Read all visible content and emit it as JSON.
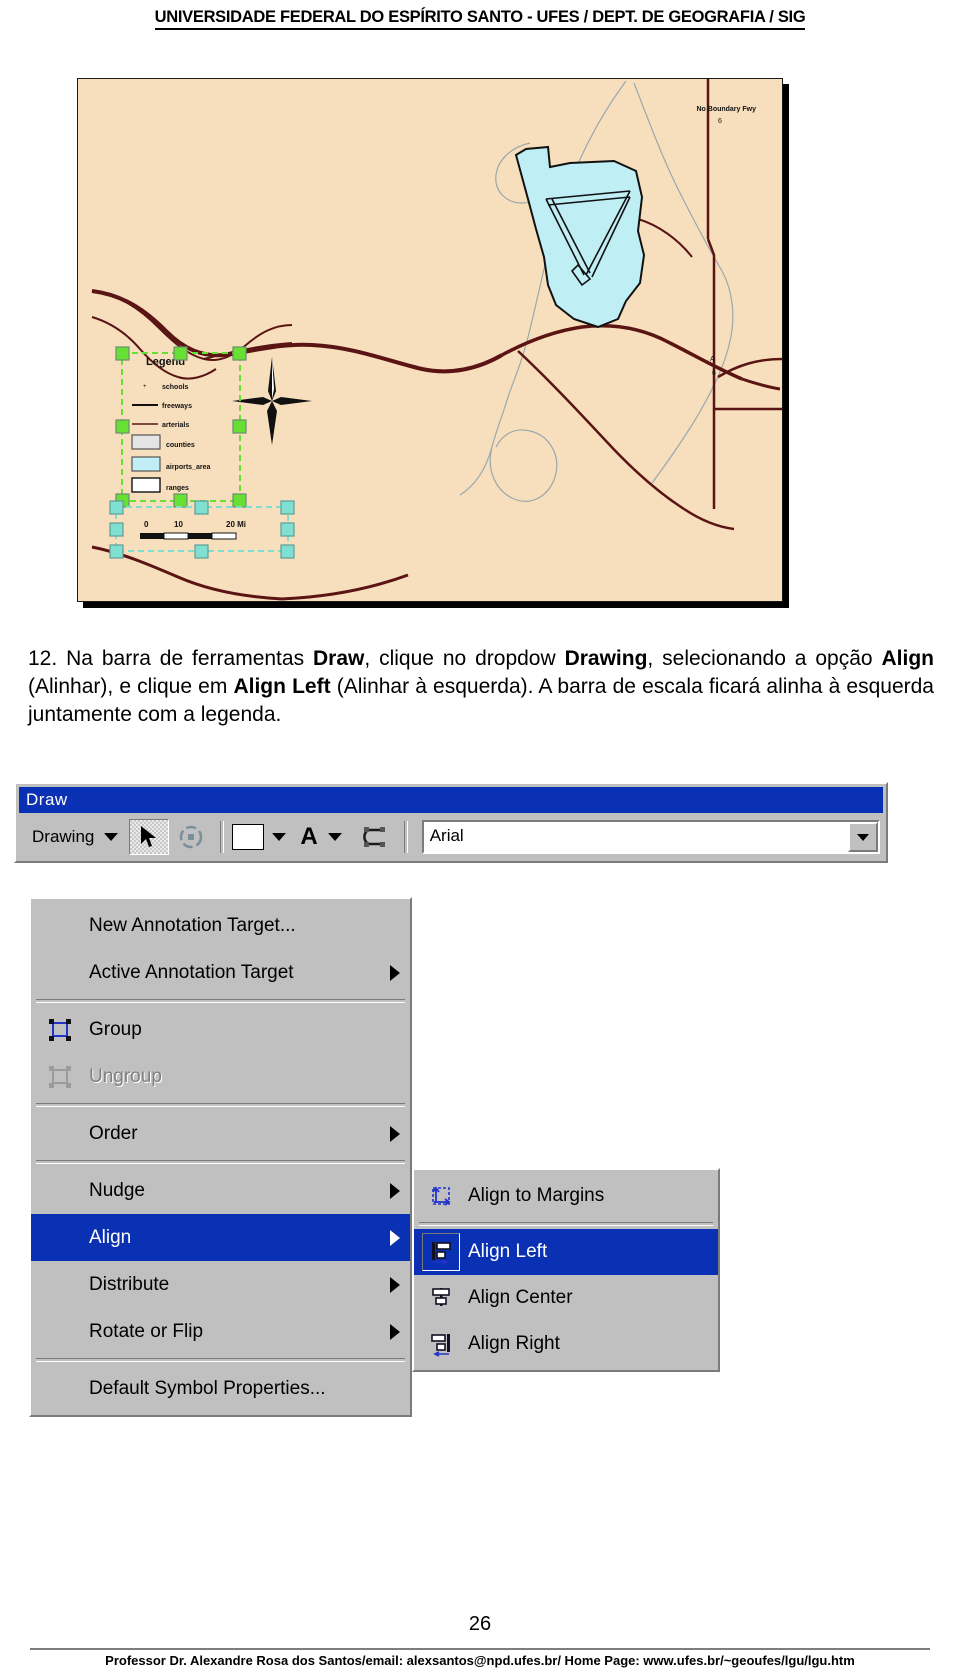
{
  "header": {
    "institution": "UNIVERSIDADE FEDERAL DO ESPÍRITO SANTO - UFES / DEPT. DE GEOGRAFIA / SIG"
  },
  "map": {
    "background_color": "#f7dfbd",
    "water_color": "#bfeef5",
    "road_color": "#5b1414",
    "label_no_boundary": "No Boundary Fwy",
    "legend": {
      "title": "Legend",
      "items": [
        {
          "label": "schools",
          "symbol": "point"
        },
        {
          "label": "freeways",
          "symbol": "line-black"
        },
        {
          "label": "arterials",
          "symbol": "line-brown"
        },
        {
          "label": "counties",
          "symbol": "polygon-grey"
        },
        {
          "label": "airports_area",
          "symbol": "polygon-cyan"
        },
        {
          "label": "ranges",
          "symbol": "polygon-white"
        }
      ],
      "selection_handle_color": "#66e033",
      "selected": true
    },
    "scalebar": {
      "labels": [
        "0",
        "10",
        "20 Mi"
      ],
      "selection_handle_color": "#7fe0d2",
      "selected": true
    },
    "north_arrow": "north-arrow"
  },
  "instruction": {
    "number": "12.",
    "segments": [
      {
        "text": "Na barra de ferramentas ",
        "bold": false
      },
      {
        "text": "Draw",
        "bold": true
      },
      {
        "text": ", clique no dropdow ",
        "bold": false
      },
      {
        "text": "Drawing",
        "bold": true
      },
      {
        "text": ", selecionando a opção ",
        "bold": false
      },
      {
        "text": "Align",
        "bold": true
      },
      {
        "text": " (Alinhar), e clique em ",
        "bold": false
      },
      {
        "text": "Align Left",
        "bold": true
      },
      {
        "text": " (Alinhar à esquerda). A barra de escala ficará alinha à esquerda juntamente com a legenda.",
        "bold": false
      }
    ]
  },
  "draw_window": {
    "title": "Draw",
    "toolbar": {
      "drawing_dropdown_label": "Drawing",
      "select_tool": "select-arrow-tool",
      "rotate_tool": "rotate-tool",
      "fill_color_label": "fill-color",
      "text_color_label": "text-color",
      "shape_tool_label": "edit-vertices-tool",
      "font_name": "Arial"
    }
  },
  "drawing_menu": {
    "items": [
      {
        "label": "New Annotation Target...",
        "icon": "",
        "submenu": false,
        "disabled": false,
        "selected": false,
        "separator_after": false
      },
      {
        "label": "Active Annotation Target",
        "icon": "",
        "submenu": true,
        "disabled": false,
        "selected": false,
        "separator_after": true
      },
      {
        "label": "Group",
        "icon": "group-icon",
        "submenu": false,
        "disabled": false,
        "selected": false,
        "separator_after": false
      },
      {
        "label": "Ungroup",
        "icon": "ungroup-icon",
        "submenu": false,
        "disabled": true,
        "selected": false,
        "separator_after": true
      },
      {
        "label": "Order",
        "icon": "",
        "submenu": true,
        "disabled": false,
        "selected": false,
        "separator_after": true
      },
      {
        "label": "Nudge",
        "icon": "",
        "submenu": true,
        "disabled": false,
        "selected": false,
        "separator_after": false
      },
      {
        "label": "Align",
        "icon": "",
        "submenu": true,
        "disabled": false,
        "selected": true,
        "separator_after": false
      },
      {
        "label": "Distribute",
        "icon": "",
        "submenu": true,
        "disabled": false,
        "selected": false,
        "separator_after": false
      },
      {
        "label": "Rotate or Flip",
        "icon": "",
        "submenu": true,
        "disabled": false,
        "selected": false,
        "separator_after": true
      },
      {
        "label": "Default Symbol Properties...",
        "icon": "",
        "submenu": false,
        "disabled": false,
        "selected": false,
        "separator_after": false
      }
    ]
  },
  "align_submenu": {
    "items": [
      {
        "label": "Align to Margins",
        "icon": "align-to-margins-icon",
        "selected": false,
        "separator_after": true
      },
      {
        "label": "Align Left",
        "icon": "align-left-icon",
        "selected": true,
        "separator_after": false
      },
      {
        "label": "Align Center",
        "icon": "align-center-icon",
        "selected": false,
        "separator_after": false
      },
      {
        "label": "Align Right",
        "icon": "align-right-icon",
        "selected": false,
        "separator_after": false
      }
    ]
  },
  "footer": {
    "page_number": "26",
    "credit": "Professor Dr. Alexandre Rosa dos Santos/email: alexsantos@npd.ufes.br/ Home Page: www.ufes.br/~geoufes/lgu/lgu.htm"
  },
  "colors": {
    "title_bar": "#0a30b4",
    "menu_face": "#c0c0c0",
    "selection_blue": "#0a30b4"
  }
}
